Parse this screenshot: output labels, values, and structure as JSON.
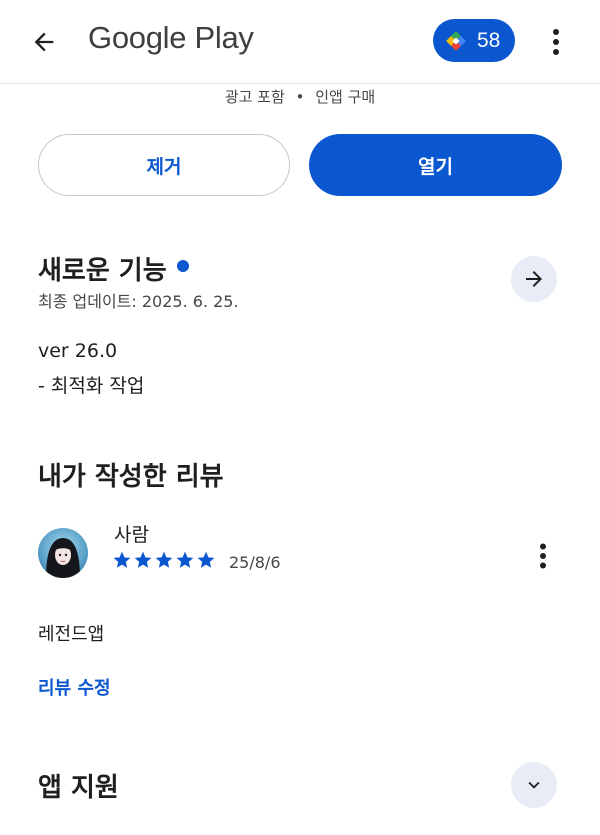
{
  "header": {
    "title": "Google Play",
    "points": "58",
    "back_icon": "arrow-left-icon",
    "more_icon": "more-vert-icon",
    "points_icon": "play-points-diamond-icon"
  },
  "app_info": {
    "ads_label": "광고 포함",
    "separator": "•",
    "iap_label": "인앱 구매"
  },
  "actions": {
    "remove_label": "제거",
    "open_label": "열기"
  },
  "whats_new": {
    "title": "새로운 기능",
    "updated": "최종 업데이트: 2025. 6. 25.",
    "version": "ver 26.0",
    "note": "- 최적화 작업"
  },
  "my_review": {
    "title": "내가 작성한 리뷰",
    "reviewer": "사람",
    "rating": 5,
    "date": "25/8/6",
    "text": "레전드앱",
    "edit_label": "리뷰 수정"
  },
  "support": {
    "title": "앱 지원"
  },
  "colors": {
    "accent": "#0b57d0",
    "round_button_bg": "#e8ecf6"
  }
}
